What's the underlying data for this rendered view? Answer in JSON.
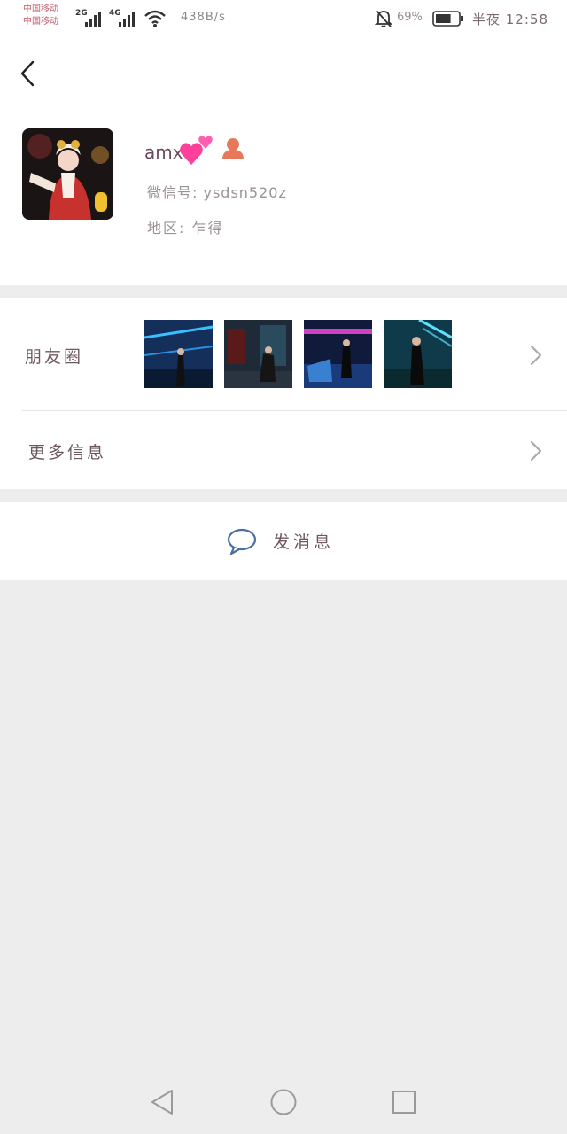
{
  "status_bar": {
    "carrier_1": "中国移动",
    "carrier_2": "中国移动",
    "network_1": "2G",
    "network_2": "4G",
    "speed": "438B/s",
    "battery_percent": "69%",
    "battery_level": 0.69,
    "time": "半夜 12:58"
  },
  "profile": {
    "name": "amx",
    "wechat_id": "微信号: ysdsn520z",
    "region": "地区: 乍得"
  },
  "rows": {
    "moments_label": "朋友圈",
    "more_info_label": "更多信息"
  },
  "actions": {
    "send_message_label": "发消息"
  },
  "icons": {
    "back": "back-arrow-icon",
    "heart": "two-hearts-emoji",
    "user": "user-icon",
    "chevron": "chevron-right-icon",
    "chat": "chat-bubble-icon",
    "nav_back": "triangle-back-icon",
    "nav_home": "circle-home-icon",
    "nav_recent": "square-recent-icon"
  },
  "colors": {
    "background": "#ededed",
    "heart": "#ff3f9a",
    "user_icon": "#e8785a",
    "chat_icon": "#4a6fa5"
  }
}
